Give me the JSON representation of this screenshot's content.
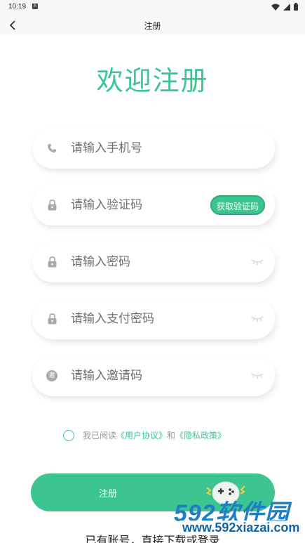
{
  "status_bar": {
    "time": "10:19",
    "notification_badge": "A"
  },
  "nav": {
    "title": "注册"
  },
  "heading": "欢迎注册",
  "fields": {
    "phone": {
      "placeholder": "请输入手机号",
      "icon": "phone-icon"
    },
    "code": {
      "placeholder": "请输入验证码",
      "icon": "lock-icon",
      "button_label": "获取验证码"
    },
    "password": {
      "placeholder": "请输入密码",
      "icon": "lock-icon"
    },
    "pay_password": {
      "placeholder": "请输入支付密码",
      "icon": "lock-icon"
    },
    "invite": {
      "placeholder": "请输入邀请码",
      "icon": "invite-badge-icon",
      "badge_text": "邀"
    }
  },
  "agreement": {
    "prefix": "我已阅读",
    "user_agreement": "《用户协议》",
    "and": "和",
    "privacy_policy": "《隐私政策》"
  },
  "register_button": {
    "label": "注册"
  },
  "login_prompt": "已有账号，直接下载或登录",
  "watermark": {
    "brand": "592软件园",
    "url": "www.592xiazai.com"
  },
  "colors": {
    "accent": "#3cc591",
    "background": "#ffffff",
    "placeholder": "#6f6f6f",
    "watermark": "#1f7ec4"
  }
}
